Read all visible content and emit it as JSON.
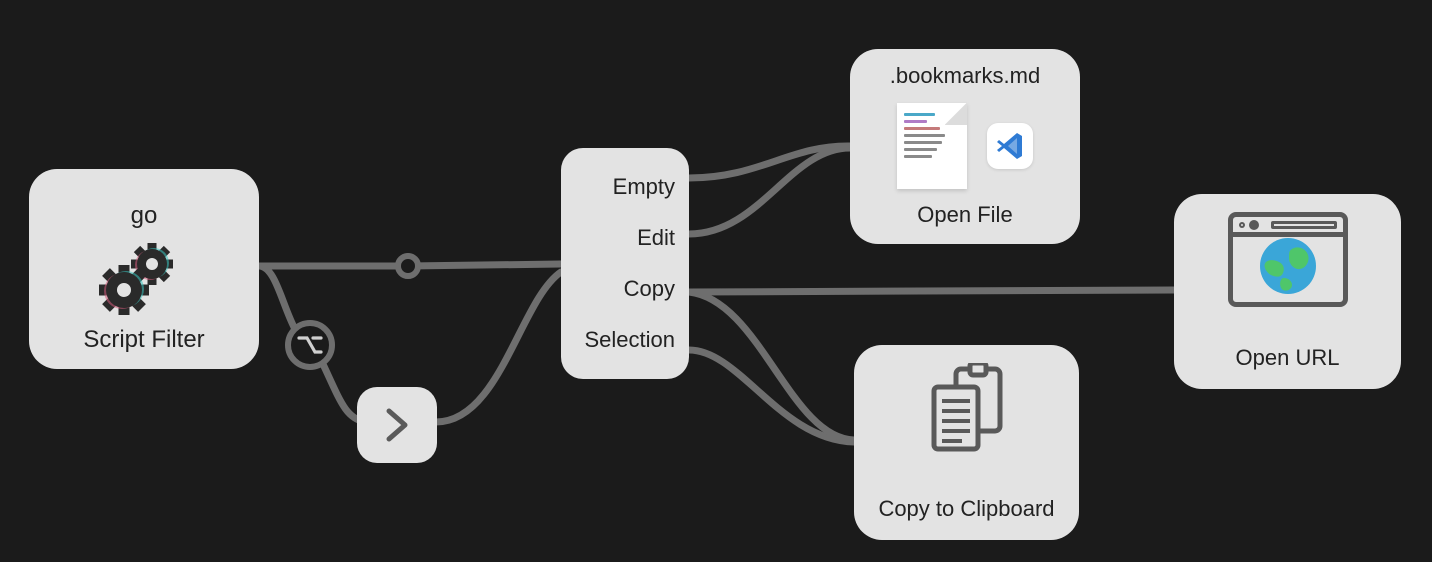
{
  "nodes": {
    "script_filter": {
      "keyword": "go",
      "label": "Script Filter"
    },
    "modifier": {
      "symbol": "⌥"
    },
    "conditional": {
      "options": [
        "Empty",
        "Edit",
        "Copy",
        "Selection"
      ]
    },
    "open_file": {
      "title": ".bookmarks.md",
      "label": "Open File"
    },
    "clipboard": {
      "label": "Copy to Clipboard"
    },
    "open_url": {
      "label": "Open URL"
    }
  }
}
